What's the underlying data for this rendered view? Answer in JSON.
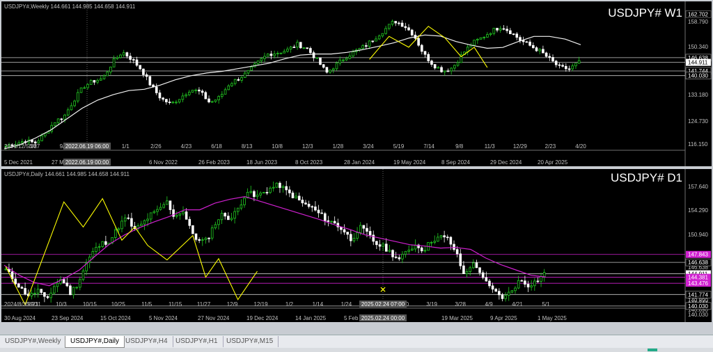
{
  "colors": {
    "background": "#000000",
    "bull": "#22cc22",
    "bear": "#ffffff",
    "ma_weekly": "#f2f2f2",
    "ma_daily": "#d020d0",
    "zigzag": "#ffff00",
    "level": "#c8c8c8",
    "level_magenta": "#d020d0",
    "axis_text": "#c0c0c0",
    "active_tab_border": "#888888"
  },
  "tabs": [
    "USDJPY#,Weekly",
    "USDJPY#,Daily",
    "USDJPY#,H4",
    "USDJPY#,H1",
    "USDJPY#,M15"
  ],
  "active_tab": 1,
  "chart_data": [
    {
      "type": "candlestick",
      "symbol_label": "USDJPY#  W1",
      "header": "USDJPY#,Weekly  144.661 144.985 144.658 144.911",
      "ylim": [
        112.5,
        163.8
      ],
      "y_ticks": [
        "158.790",
        "150.340",
        "133.180",
        "124.730",
        "116.150"
      ],
      "price_badges": [
        {
          "value": "162.702",
          "style": "box"
        },
        {
          "value": "146.638",
          "style": "line"
        },
        {
          "value": "144.911",
          "style": "current"
        },
        {
          "value": "141.744",
          "style": "line"
        },
        {
          "value": "140.030",
          "style": "line"
        }
      ],
      "x_ticks": [
        "5 Dec 2021",
        "27 Ma",
        "6 Nov 2022",
        "26 Feb 2023",
        "18 Jun 2023",
        "8 Oct 2023",
        "28 Jan 2024",
        "19 May 2024",
        "8 Sep 2024",
        "29 Dec 2024",
        "20 Apr 2025"
      ],
      "x_ticks_top": [
        "2021/12/5/30",
        "3/27",
        "9/11",
        "11/6",
        "1/1",
        "2/26",
        "4/23",
        "6/18",
        "8/13",
        "10/8",
        "12/3",
        "1/28",
        "3/24",
        "5/19",
        "7/14",
        "9/8",
        "11/3",
        "12/29",
        "2/23",
        "4/20"
      ],
      "crosshair_time": "2022.06.19 06:00",
      "crosshair_time_bottom": "2022.06.19 00:00",
      "key_prices": [
        114.0,
        115.0,
        116.0,
        115.2,
        118.3,
        123.0,
        125.0,
        131.0,
        136.0,
        138.0,
        139.0,
        145.0,
        148.8,
        146.0,
        142.0,
        136.0,
        131.5,
        129.5,
        132.0,
        135.0,
        134.0,
        130.0,
        132.0,
        137.0,
        139.0,
        141.5,
        145.0,
        148.0,
        148.5,
        149.5,
        151.6,
        150.0,
        146.0,
        141.0,
        144.0,
        147.0,
        149.0,
        151.0,
        154.0,
        157.0,
        160.2,
        158.5,
        155.0,
        148.0,
        144.0,
        141.7,
        143.0,
        148.0,
        152.0,
        154.0,
        156.5,
        158.2,
        156.0,
        153.0,
        151.0,
        149.0,
        146.0,
        143.0,
        142.5,
        144.9
      ],
      "ma_prices": [
        113.0,
        114.5,
        117.0,
        120.0,
        124.0,
        128.0,
        131.0,
        133.0,
        134.5,
        135.0,
        136.5,
        138.5,
        140.0,
        141.0,
        141.6,
        142.6,
        143.6,
        144.6,
        146.2,
        147.6,
        148.0,
        148.0,
        148.6,
        149.6,
        150.8,
        152.1,
        153.9,
        155.0,
        154.6,
        152.6,
        151.2,
        150.1,
        150.4,
        152.6,
        154.5,
        154.5,
        153.5,
        151.4
      ],
      "zigzag": [
        [
          111,
          146.0
        ],
        [
          117,
          154.5
        ],
        [
          123,
          150.5
        ],
        [
          129,
          158.2
        ],
        [
          134,
          154.0
        ],
        [
          139,
          147.0
        ],
        [
          143,
          150.5
        ],
        [
          147,
          143.0
        ]
      ],
      "horizontal_levels": [
        146.638,
        144.911,
        141.744,
        140.03
      ]
    },
    {
      "type": "candlestick",
      "symbol_label": "USDJPY#  D1",
      "header": "USDJPY#,Daily  144.661 144.985 144.658 144.911",
      "ylim": [
        139.7,
        159.3
      ],
      "y_ticks": [
        "157.640",
        "154.290",
        "150.940",
        "146.638",
        "141.744",
        "140.030",
        "140.890"
      ],
      "price_badges": [
        {
          "value": "147.843",
          "style": "magenta"
        },
        {
          "value": "146.638",
          "style": "line"
        },
        {
          "value": "144.911",
          "style": "current"
        },
        {
          "value": "144.381",
          "style": "magenta"
        },
        {
          "value": "143.476",
          "style": "magenta"
        },
        {
          "value": "141.774",
          "style": "line"
        },
        {
          "value": "140.890",
          "style": "text"
        },
        {
          "value": "140.030",
          "style": "line"
        }
      ],
      "x_ticks": [
        "30 Aug 2024",
        "23 Sep 2024",
        "15 Oct 2024",
        "5 Nov 2024",
        "27 Nov 2024",
        "19 Dec 2024",
        "14 Jan 2025",
        "5 Feb 2",
        "2025",
        "19 Mar 2025",
        "9 Apr 2025",
        "1 May 2025"
      ],
      "x_ticks_top": [
        "2024/8/30/9/11",
        "9/23",
        "10/3",
        "10/15",
        "10/25",
        "11/5",
        "11/15",
        "11/27",
        "12/9",
        "12/19",
        "1/2",
        "1/14",
        "1/24",
        "2/5",
        "3/10",
        "3/19",
        "3/28",
        "4/9",
        "4/21",
        "5/1"
      ],
      "crosshair_time": "2025.02.24 07:00",
      "crosshair_time_bottom": "2025.02.24 00:00",
      "key_prices": [
        145.5,
        144.0,
        142.5,
        141.5,
        142.5,
        140.8,
        143.0,
        144.2,
        142.0,
        143.5,
        146.5,
        148.5,
        149.5,
        150.0,
        152.0,
        153.5,
        151.5,
        152.5,
        153.8,
        154.5,
        155.9,
        153.5,
        154.6,
        151.5,
        149.8,
        150.0,
        152.5,
        154.0,
        153.2,
        155.0,
        157.5,
        156.5,
        157.2,
        157.9,
        158.4,
        157.3,
        156.5,
        155.5,
        155.0,
        154.0,
        153.0,
        152.5,
        151.5,
        150.0,
        152.0,
        151.0,
        149.5,
        149.0,
        148.0,
        147.0,
        148.5,
        149.3,
        148.5,
        150.0,
        150.5,
        150.2,
        148.2,
        144.7,
        146.5,
        145.3,
        143.0,
        142.0,
        141.2,
        142.5,
        144.0,
        143.2,
        143.8,
        144.9
      ],
      "ma_prices": [
        146.2,
        144.7,
        143.6,
        143.1,
        144.2,
        145.5,
        147.5,
        149.4,
        150.8,
        151.9,
        152.8,
        153.6,
        154.6,
        154.6,
        155.6,
        156.2,
        156.6,
        155.9,
        155.2,
        154.5,
        153.8,
        153.1,
        152.3,
        151.6,
        150.8,
        150.3,
        149.8,
        149.3,
        149.1,
        148.8,
        148.9,
        148.6,
        147.3,
        146.3,
        145.5,
        144.7,
        144.4
      ],
      "zigzag": [
        [
          0,
          146.0
        ],
        [
          6,
          140.2
        ],
        [
          18,
          155.8
        ],
        [
          24,
          152.0
        ],
        [
          30,
          156.3
        ],
        [
          36,
          150.0
        ],
        [
          40,
          152.0
        ],
        [
          44,
          149.2
        ],
        [
          50,
          147.0
        ],
        [
          58,
          150.7
        ],
        [
          62,
          144.4
        ],
        [
          66,
          147.2
        ],
        [
          72,
          141.0
        ],
        [
          78,
          145.3
        ]
      ],
      "horizontal_levels": [
        147.843,
        146.638,
        144.911,
        144.381,
        143.476,
        141.774,
        140.03
      ],
      "marker_price": 142.5
    }
  ]
}
